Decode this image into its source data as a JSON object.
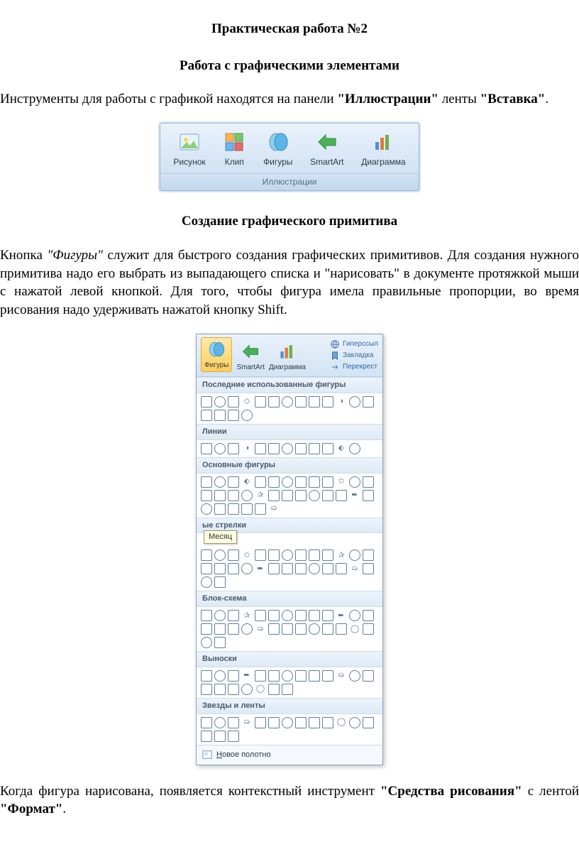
{
  "title": "Практическая работа №2",
  "subtitle": "Работа с графическими элементами",
  "para1": {
    "t1": "Инструменты для работы с графикой находятся на панели ",
    "b1": "\"Иллюстрации\"",
    "t2": " ленты ",
    "b2": "\"Вставка\"",
    "t3": "."
  },
  "ribbon": {
    "group_label": "Иллюстрации",
    "items": [
      {
        "label": "Рисунок"
      },
      {
        "label": "Клип"
      },
      {
        "label": "Фигуры"
      },
      {
        "label": "SmartArt"
      },
      {
        "label": "Диаграмма"
      }
    ]
  },
  "section2_title": "Создание графического примитива",
  "para2": {
    "t1": "Кнопка ",
    "i1": "\"Фигуры\"",
    "t2": " служит для быстрого создания графических примитивов. Для создания нужного примитива надо его выбрать из выпадающего списка и \"нарисовать\" в документе протяжкой мыши с нажатой левой кнопкой. Для того, чтобы фигура имела правильные пропорции, во время рисования надо удерживать нажатой кнопку Shift."
  },
  "shapes": {
    "top_buttons": [
      {
        "label": "Фигуры"
      },
      {
        "label": "SmartArt"
      },
      {
        "label": "Диаграмма"
      }
    ],
    "top_links": [
      "Гиперссыл",
      "Закладка",
      "Перекрест"
    ],
    "sections": [
      {
        "title": "Последние использованные фигуры",
        "count": 17
      },
      {
        "title": "Линии",
        "count": 12
      },
      {
        "title": "Основные фигуры",
        "count": 32
      },
      {
        "title": "ые стрелки",
        "count": 28,
        "tooltip": "Месяц"
      },
      {
        "title": "Блок-схема",
        "count": 28
      },
      {
        "title": "Выноски",
        "count": 20
      },
      {
        "title": "Звезды и ленты",
        "count": 16
      }
    ],
    "canvas": {
      "prefix": "Н",
      "rest": "овое полотно"
    }
  },
  "para3": {
    "t1": "Когда фигура нарисована, появляется контекстный инструмент ",
    "b1": "\"Средства рисования\"",
    "t2": " с лентой ",
    "b2": "\"Формат\"",
    "t3": "."
  }
}
